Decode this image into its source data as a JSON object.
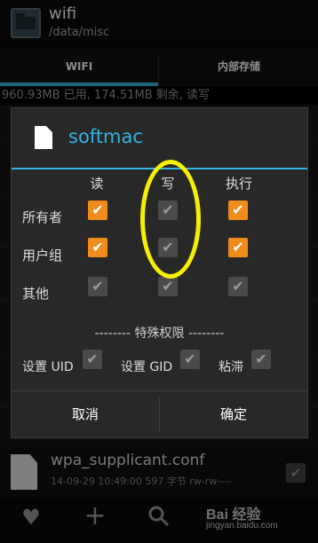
{
  "app": {
    "title": "wifi",
    "path": "/data/misc",
    "icon": "folder-app-icon"
  },
  "tabs": [
    {
      "label": "WIFI",
      "selected": true
    },
    {
      "label": "内部存储",
      "selected": false
    }
  ],
  "storage_info": "960.93MB 已用, 174.51MB 剩余, 读写",
  "dialog": {
    "title": "softmac",
    "columns": [
      "读",
      "写",
      "执行"
    ],
    "rows": [
      {
        "label": "所有者",
        "read": true,
        "write": false,
        "exec": true
      },
      {
        "label": "用户组",
        "read": true,
        "write": false,
        "exec": true
      },
      {
        "label": "其他",
        "read": false,
        "write": false,
        "exec": false
      }
    ],
    "special_title": "-------- 特殊权限 --------",
    "special": [
      {
        "label": "设置 UID",
        "checked": false
      },
      {
        "label": "设置 GID",
        "checked": false
      },
      {
        "label": "粘滞",
        "checked": false
      }
    ],
    "cancel_label": "取消",
    "ok_label": "确定"
  },
  "file_row": {
    "name": "wpa_supplicant.conf",
    "meta": "14-09-29 10:49:00  597 字节  rw-rw----"
  },
  "bottom_bar": [
    "heart-icon",
    "add-icon",
    "search-icon"
  ],
  "watermark": {
    "brand": "Bai 经验",
    "url": "jingyan.baidu.com"
  },
  "colors": {
    "accent": "#33b5e5",
    "checkbox_on": "#f08c1c",
    "highlight": "#f6ef00"
  }
}
